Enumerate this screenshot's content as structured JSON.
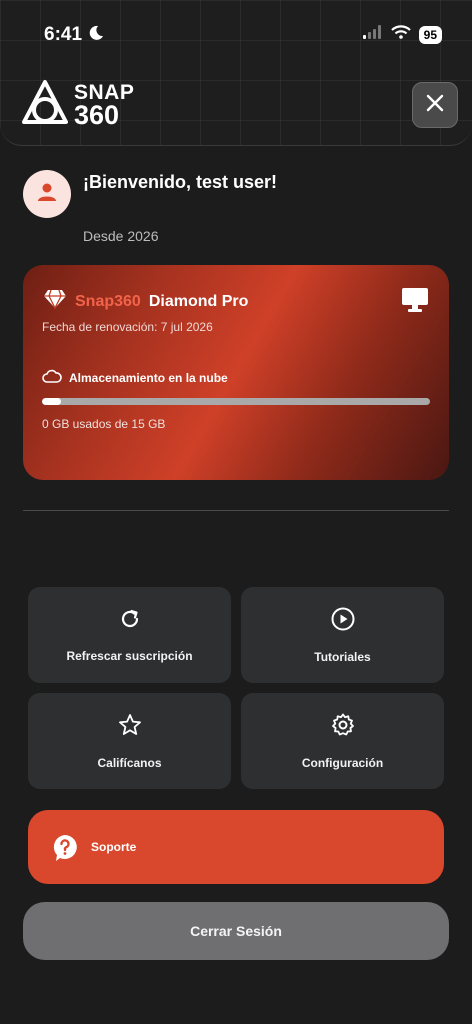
{
  "status_bar": {
    "time": "6:41",
    "battery": "95"
  },
  "header": {
    "logo_line1": "SNAP",
    "logo_line2": "360"
  },
  "profile": {
    "welcome": "¡Bienvenido, test user!",
    "since": "Desde 2026"
  },
  "subscription": {
    "brand": "Snap360",
    "plan": "Diamond Pro",
    "renewal": "Fecha de renovación: 7 jul 2026",
    "storage_label": "Almacenamiento en la nube",
    "storage_usage": "0 GB usados de 15 GB",
    "storage_used_fraction": 0.05
  },
  "actions": {
    "refresh": "Refrescar suscripción",
    "tutorials": "Tutoriales",
    "rate": "Califícanos",
    "settings": "Configuración"
  },
  "support": {
    "label": "Soporte"
  },
  "logout": {
    "label": "Cerrar Sesión"
  },
  "colors": {
    "accent": "#d9482c",
    "background": "#1c1c1c",
    "tile": "#2e2f31"
  }
}
